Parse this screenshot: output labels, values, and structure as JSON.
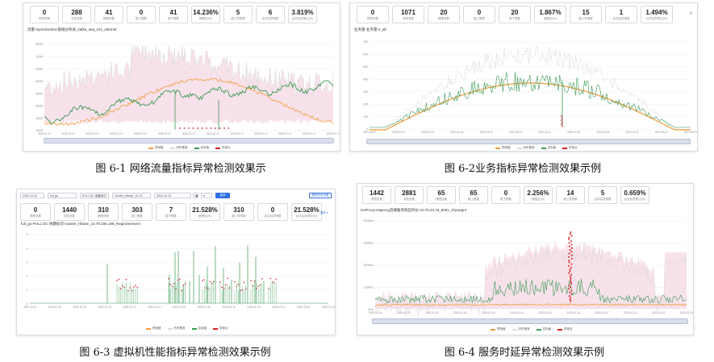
{
  "figures": [
    {
      "caption": "图 6-1 网络流量指标异常检测效果示",
      "title": "流量-topicSizeOut-基础分析表_kafka_seq_101_internet",
      "stats": [
        {
          "value": "0",
          "label": "预测总数"
        },
        {
          "value": "288",
          "label": "未知总数"
        },
        {
          "value": "41",
          "label": "超限总数"
        },
        {
          "value": "0",
          "label": "超上限数"
        },
        {
          "value": "41",
          "label": "超下限数"
        },
        {
          "value": "14.236%",
          "label": "超限比(%)"
        },
        {
          "value": "5",
          "label": "超上异常数"
        },
        {
          "value": "6",
          "label": "合并后异常数"
        },
        {
          "value": "3.819%",
          "label": "合并后异常比(%)"
        }
      ],
      "y_ticks": [
        "800M",
        "700M",
        "600M",
        "500M",
        "400M",
        "300M",
        "200M",
        "100M"
      ],
      "x_ticks": [
        "2020-01-17",
        "2020-01-17",
        "2020-01-17",
        "2020-01-17",
        "2020-01-17",
        "2020-01-17",
        "2020-01-17",
        "2020-01-17",
        "2020-01-17",
        "2020-01-17",
        "2020-01-17",
        "2020-01-17",
        "2020-01-17"
      ],
      "legend": [
        "预测值",
        "历史基准",
        "实际值",
        "异常点"
      ]
    },
    {
      "caption": "图 6-2业务指标异常检测效果示例",
      "title": "业务量-业务量-4_all",
      "stats": [
        {
          "value": "0",
          "label": "预测总数"
        },
        {
          "value": "1071",
          "label": "未知总数"
        },
        {
          "value": "20",
          "label": "超限总数"
        },
        {
          "value": "0",
          "label": "超上限数"
        },
        {
          "value": "20",
          "label": "超下限数"
        },
        {
          "value": "1.867%",
          "label": "超限比(%)"
        },
        {
          "value": "15",
          "label": "超上异常数"
        },
        {
          "value": "1",
          "label": "合并后异常数"
        },
        {
          "value": "1.494%",
          "label": "合并后异常比(%)"
        }
      ],
      "y_ticks": [
        "700",
        "600",
        "500",
        "400",
        "300",
        "200",
        "100",
        "0"
      ],
      "x_ticks": [
        "2020-04-01",
        "2020-04-01",
        "2020-04-01",
        "2020-04-01",
        "2020-04-01",
        "2020-04-01",
        "2020-04-01",
        "2020-04-01",
        "2020-04-01",
        "2020-04-01",
        "2020-04-01",
        "2020-04-01"
      ],
      "legend": [
        "预测值",
        "历史基准",
        "实际值",
        "异常点"
      ]
    },
    {
      "caption": "图 6-3 虚拟机性能指标异常检测效果示例",
      "title": "full_go-PULL DC 地震标识-Cluster_Hbase_10.78.195.186_RegionServer4",
      "controls": [
        "2020-10-10",
        "full_go",
        "PULL DC 地震标识",
        "Cluster_Hbase_10.78...",
        "2020-10-10",
        "查询",
        "导出",
        "模型校验设置"
      ],
      "more": "展开 ▾",
      "stats": [
        {
          "value": "0",
          "label": "预测总数"
        },
        {
          "value": "1440",
          "label": "未知总数"
        },
        {
          "value": "310",
          "label": "超限总数"
        },
        {
          "value": "303",
          "label": "超上限数"
        },
        {
          "value": "7",
          "label": "超下限数"
        },
        {
          "value": "21.528%",
          "label": "超限比(%)"
        },
        {
          "value": "310",
          "label": "超上异常数"
        },
        {
          "value": "0",
          "label": "合并后异常数"
        },
        {
          "value": "21.528%",
          "label": "合并后异常比(%)"
        }
      ],
      "y_ticks": [
        "5",
        "4",
        "3",
        "2",
        "1",
        "0"
      ],
      "x_ticks": [
        "2020-10-10",
        "2020-10-10",
        "2020-10-10",
        "2020-10-10",
        "2020-10-10",
        "2020-10-10",
        "2020-10-10",
        "2020-10-10",
        "2020-10-10",
        "2020-10-10",
        "2020-10-10",
        "2020-10-10",
        "2020-10-10"
      ],
      "legend": [
        "预测值",
        "历史基准",
        "实际值",
        "异常点"
      ]
    },
    {
      "caption": "图 6-4 服务时延异常检测效果示例",
      "title": "HAProxy-Haproxy后端服务响应时长-10.78.23.76_9001_zhyswgnt",
      "stats": [
        {
          "value": "1442",
          "label": "预测总数"
        },
        {
          "value": "2881",
          "label": "未知总数"
        },
        {
          "value": "65",
          "label": "超限总数"
        },
        {
          "value": "65",
          "label": "超上限数"
        },
        {
          "value": "0",
          "label": "超下限数"
        },
        {
          "value": "2.256%",
          "label": "超限比(%)"
        },
        {
          "value": "14",
          "label": "超上异常数"
        },
        {
          "value": "5",
          "label": "合并后异常数"
        },
        {
          "value": "0.659%",
          "label": "合并后异常比(%)"
        }
      ],
      "y_ticks": [
        "4000ms",
        "3000ms",
        "2000ms",
        "1000ms",
        "0ms"
      ],
      "x_ticks": [
        "2020-01-24",
        "2020-01-24",
        "2020-01-24",
        "2020-01-24",
        "2020-01-24",
        "2020-01-24",
        "2020-01-24",
        "2020-01-24",
        "2020-01-24",
        "2020-01-24",
        "2020-01-24",
        "2020-01-24"
      ],
      "legend": [
        "预测值",
        "历史基准",
        "实际值",
        "异常点"
      ]
    }
  ],
  "colors": {
    "predicted": "#f29b38",
    "baseline": "#d9d9d9",
    "band": "#f7e1ea",
    "actual": "#3a9a55",
    "anomaly": "#d92020"
  }
}
